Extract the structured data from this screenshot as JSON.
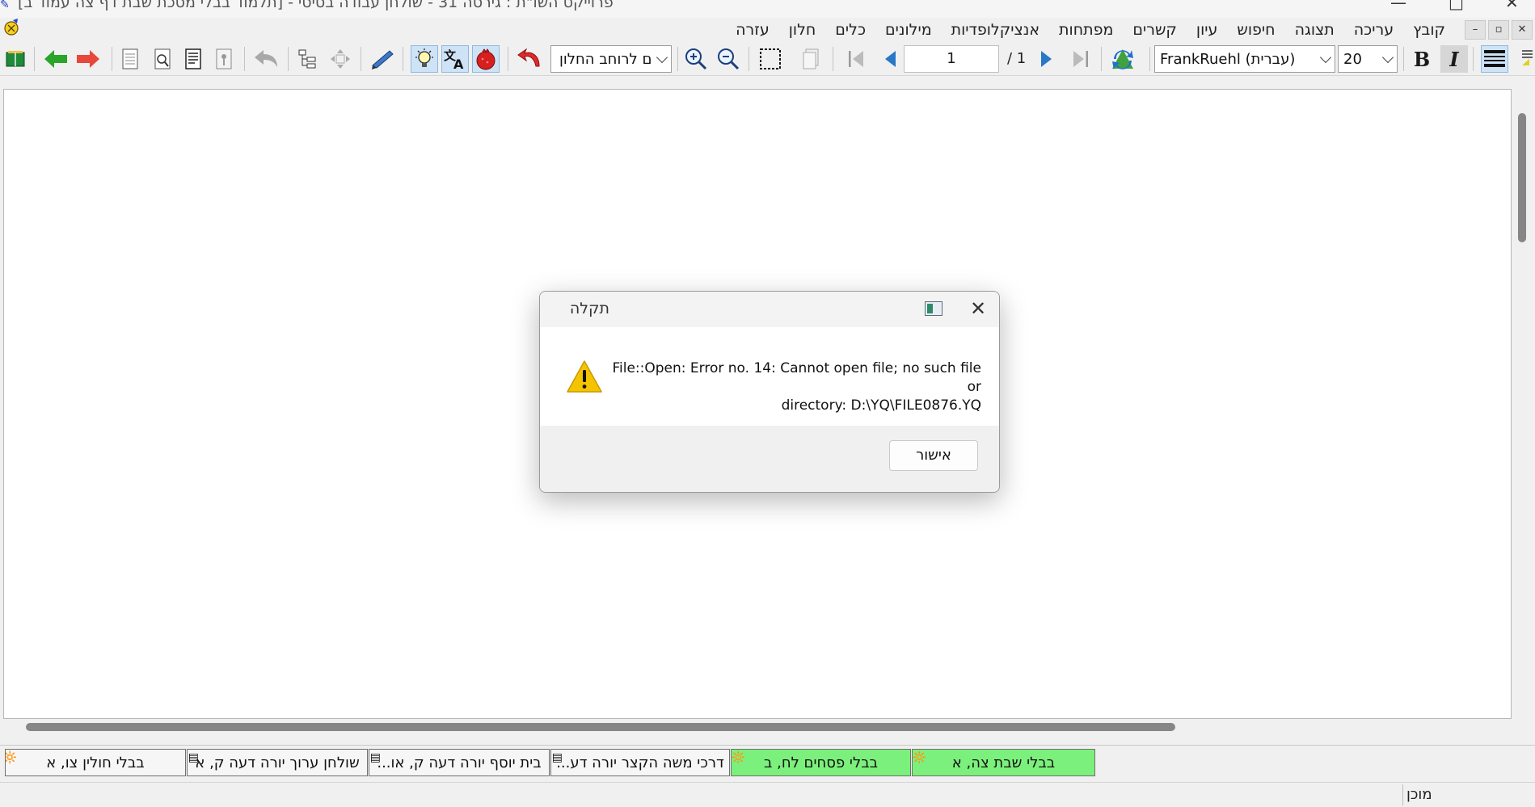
{
  "window": {
    "title": "פרוייקט השו\"ת : גירסה 31 - שולחן עבודה בסיסי - [תלמוד בבלי מסכת שבת דף צה עמוד ב]",
    "minimize": "—",
    "maximize": "□",
    "close": "✕"
  },
  "menu": {
    "items": [
      "קובץ",
      "עריכה",
      "תצוגה",
      "חיפוש",
      "עיון",
      "קשרים",
      "מפתחות",
      "אנציקלופדיות",
      "מילונים",
      "כלים",
      "חלון",
      "עזרה"
    ],
    "mdi_minimize": "–",
    "mdi_restore": "▫",
    "mdi_close": "✕"
  },
  "toolbar": {
    "view_mode": "ם לרוחב החלון",
    "page_number": "1",
    "page_total": "/ 1",
    "font_name": "FrankRuehl (עברית)",
    "font_size": "20",
    "bold_label": "B",
    "italic_label": "I"
  },
  "dialog": {
    "title": "תקלה",
    "message_line1": "File::Open: Error no. 14: Cannot open file; no such file or",
    "message_line2": "directory: D:\\YQ\\FILE0876.YQ",
    "ok_label": "אישור",
    "close_label": "✕"
  },
  "tabs": [
    {
      "label": "בבלי שבת צה, א",
      "green": true
    },
    {
      "label": "בבלי פסחים לח, ב",
      "green": true
    },
    {
      "label": "דרכי משה הקצר יורה דע...",
      "green": false
    },
    {
      "label": "בית יוסף יורה דעה ק, או...",
      "green": false
    },
    {
      "label": "שולחן ערוך יורה דעה ק, א",
      "green": false
    },
    {
      "label": "בבלי חולין צו, א",
      "green": false
    }
  ],
  "status": {
    "text": "מוכן"
  },
  "colors": {
    "tab_active_green": "#7cf07c",
    "arrow_back_green": "#2aa52a",
    "arrow_forward_red": "#e8473b",
    "warning_yellow": "#f5c400"
  }
}
